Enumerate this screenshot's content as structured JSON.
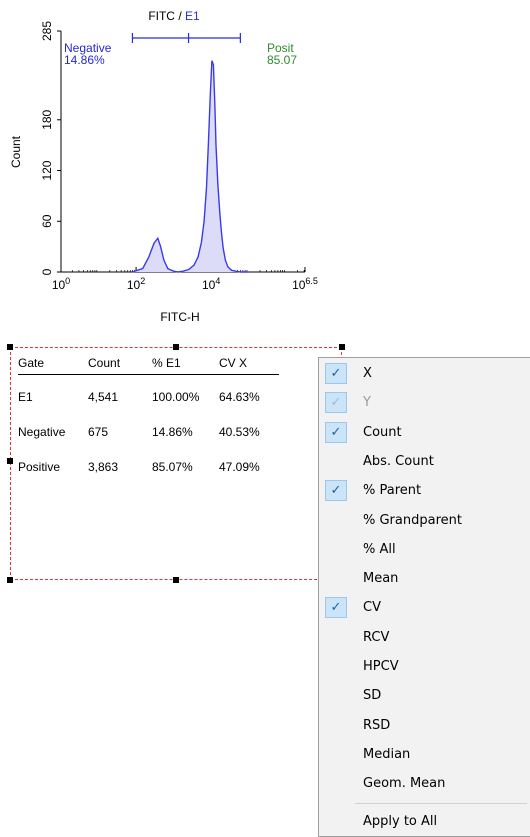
{
  "chart_data": {
    "type": "area",
    "title": "FITC / E1",
    "title_parts": [
      "FITC",
      " / ",
      "E1"
    ],
    "xlabel": "FITC-H",
    "ylabel": "Count",
    "x_scale": "log",
    "xlim": [
      1,
      3162277.66
    ],
    "ylim": [
      0,
      285
    ],
    "x_tick_labels": [
      {
        "base": "10",
        "exp": "0",
        "value": 1
      },
      {
        "base": "10",
        "exp": "2",
        "value": 100
      },
      {
        "base": "10",
        "exp": "4",
        "value": 10000
      },
      {
        "base": "10",
        "exp": "6.5",
        "value": 3162277.66
      }
    ],
    "y_ticks": [
      0,
      60,
      120,
      180,
      285
    ],
    "series": [
      {
        "x": [
          80,
          150,
          220,
          300,
          380,
          450,
          550,
          700,
          1000,
          1300,
          1800,
          2500,
          3500,
          4500,
          5500,
          6500,
          7500,
          8500,
          9500,
          10500,
          11500,
          12500,
          13500,
          15000,
          17000,
          19000,
          21000,
          24000,
          28000,
          35000,
          45000,
          60000,
          100000
        ],
        "values": [
          0,
          4,
          18,
          34,
          40,
          30,
          14,
          4,
          1,
          0,
          1,
          3,
          8,
          18,
          35,
          60,
          100,
          155,
          210,
          250,
          245,
          200,
          150,
          105,
          70,
          45,
          28,
          14,
          6,
          2,
          1,
          0,
          0
        ],
        "color": "#3a3aeb",
        "fill": "#dcdcf8"
      }
    ],
    "gates": [
      {
        "name": "Negative",
        "percent": "14.86%",
        "range": [
          80,
          2500
        ],
        "color": "#2626d9"
      },
      {
        "name": "Positive",
        "percent": "85.07%",
        "range": [
          2500,
          60000
        ],
        "color": "#2e8b2e"
      }
    ],
    "gate_labels": {
      "negative_name": "Negative",
      "negative_pct": "14.86%",
      "positive_name": "Posit",
      "positive_pct": "85.07"
    },
    "gate_bar_color": "#2a2ad8",
    "title_gate_color": "#2a2ad8"
  },
  "stats": {
    "headers": [
      "Gate",
      "Count",
      "% E1",
      "CV X"
    ],
    "rows": [
      {
        "gate": "E1",
        "count": "4,541",
        "pct": "100.00%",
        "cv": "64.63%"
      },
      {
        "gate": "Negative",
        "count": "675",
        "pct": "14.86%",
        "cv": "40.53%"
      },
      {
        "gate": "Positive",
        "count": "3,863",
        "pct": "85.07%",
        "cv": "47.09%"
      }
    ]
  },
  "context_menu": {
    "check_glyph": "✓",
    "items": [
      {
        "label": "X",
        "checked": true,
        "enabled": true
      },
      {
        "label": "Y",
        "checked": true,
        "enabled": false
      },
      {
        "label": "Count",
        "checked": true,
        "enabled": true
      },
      {
        "label": "Abs. Count",
        "checked": false,
        "enabled": true
      },
      {
        "label": "% Parent",
        "checked": true,
        "enabled": true
      },
      {
        "label": "% Grandparent",
        "checked": false,
        "enabled": true
      },
      {
        "label": "% All",
        "checked": false,
        "enabled": true
      },
      {
        "label": "Mean",
        "checked": false,
        "enabled": true
      },
      {
        "label": "CV",
        "checked": true,
        "enabled": true
      },
      {
        "label": "RCV",
        "checked": false,
        "enabled": true
      },
      {
        "label": "HPCV",
        "checked": false,
        "enabled": true
      },
      {
        "label": "SD",
        "checked": false,
        "enabled": true
      },
      {
        "label": "RSD",
        "checked": false,
        "enabled": true
      },
      {
        "label": "Median",
        "checked": false,
        "enabled": true
      },
      {
        "label": "Geom. Mean",
        "checked": false,
        "enabled": true
      }
    ],
    "footer_item": {
      "label": "Apply to All"
    }
  }
}
